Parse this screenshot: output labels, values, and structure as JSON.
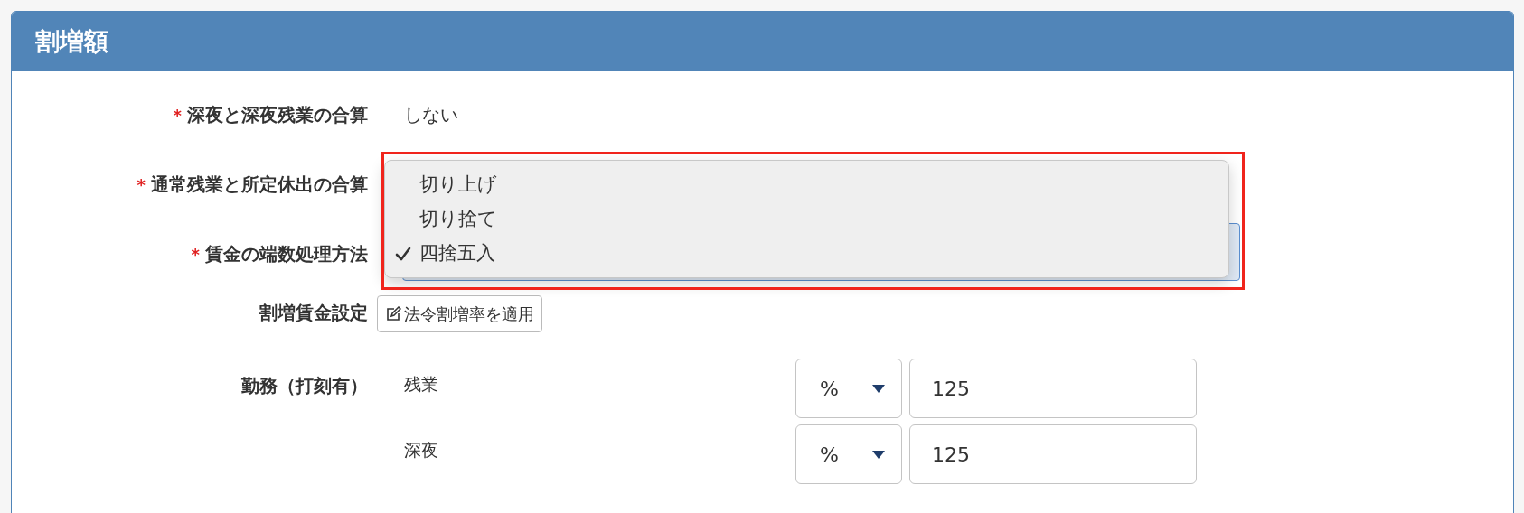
{
  "panel": {
    "title": "割増額"
  },
  "fields": [
    {
      "required_mark": "*",
      "label": "深夜と深夜残業の合算",
      "kind": "text",
      "value": "しない"
    },
    {
      "required_mark": "*",
      "label": "通常残業と所定休出の合算",
      "kind": "covered"
    },
    {
      "required_mark": "*",
      "label": "賃金の端数処理方法",
      "kind": "select",
      "focused": true
    }
  ],
  "dropdown": {
    "highlighted": true,
    "options": [
      {
        "label": "切り上げ",
        "selected": false
      },
      {
        "label": "切り捨て",
        "selected": false
      },
      {
        "label": "四捨五入",
        "selected": true
      }
    ]
  },
  "premium_setting": {
    "label": "割増賃金設定",
    "button": "法令割増率を適用"
  },
  "work_group": {
    "label": "勤務（打刻有）",
    "rows": [
      {
        "label": "残業",
        "unit": "%",
        "value": "125"
      },
      {
        "label": "深夜",
        "unit": "%",
        "value": "125"
      }
    ]
  }
}
